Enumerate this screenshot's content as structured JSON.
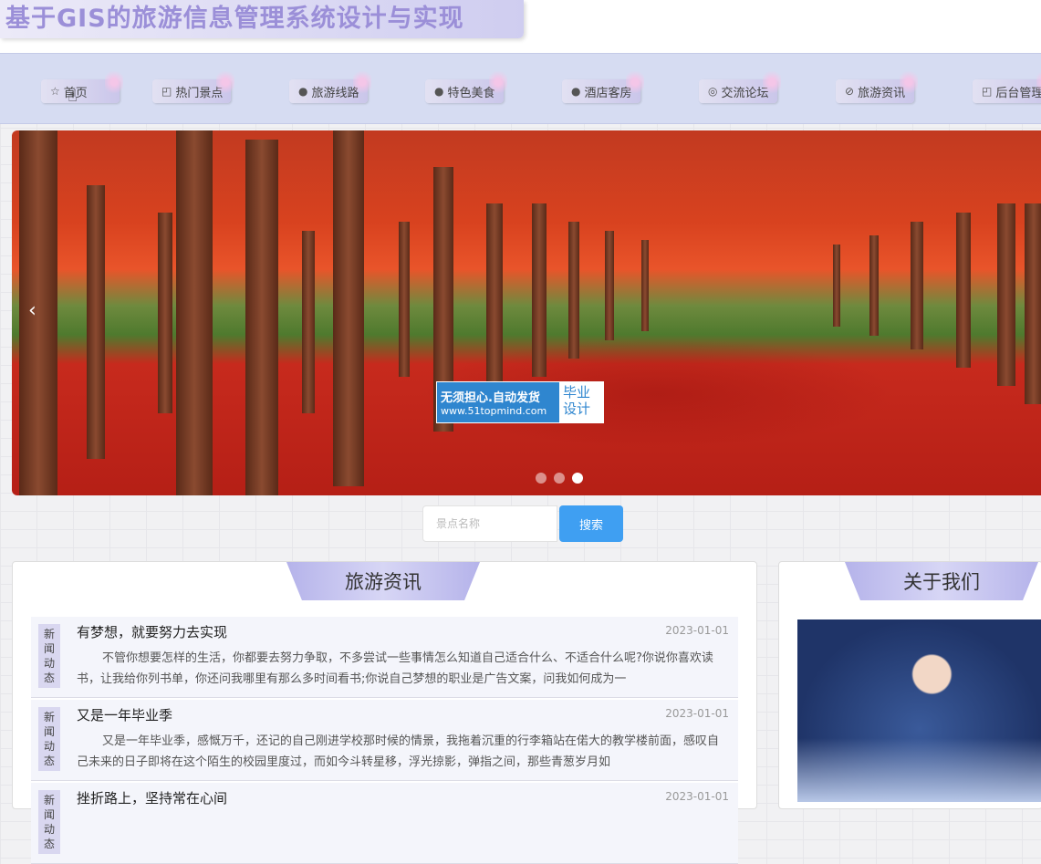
{
  "header": {
    "title": "基于GIS的旅游信息管理系统设计与实现"
  },
  "nav": {
    "items": [
      {
        "icon": "☆",
        "label": "首页"
      },
      {
        "icon": "◰",
        "label": "热门景点"
      },
      {
        "icon": "●",
        "label": "旅游线路"
      },
      {
        "icon": "●",
        "label": "特色美食"
      },
      {
        "icon": "●",
        "label": "酒店客房"
      },
      {
        "icon": "◎",
        "label": "交流论坛"
      },
      {
        "icon": "⊘",
        "label": "旅游资讯"
      },
      {
        "icon": "◰",
        "label": "后台管理"
      }
    ]
  },
  "banner": {
    "prev_icon": "‹",
    "active_slide": 3,
    "watermark": {
      "line1": "无须担心.自动发货",
      "line2": "www.51topmind.com",
      "right": "毕业设计"
    }
  },
  "search": {
    "placeholder": "景点名称",
    "button_label": "搜索"
  },
  "news": {
    "heading": "旅游资讯",
    "items": [
      {
        "tag": [
          "新",
          "闻",
          "动",
          "态"
        ],
        "title": "有梦想，就要努力去实现",
        "date": "2023-01-01",
        "body": "不管你想要怎样的生活，你都要去努力争取，不多尝试一些事情怎么知道自己适合什么、不适合什么呢?你说你喜欢读书，让我给你列书单，你还问我哪里有那么多时间看书;你说自己梦想的职业是广告文案，问我如何成为一"
      },
      {
        "tag": [
          "新",
          "闻",
          "动",
          "态"
        ],
        "title": "又是一年毕业季",
        "date": "2023-01-01",
        "body": "又是一年毕业季，感慨万千，还记的自己刚进学校那时候的情景，我拖着沉重的行李箱站在偌大的教学楼前面，感叹自己未来的日子即将在这个陌生的校园里度过，而如今斗转星移，浮光掠影，弹指之间，那些青葱岁月如"
      },
      {
        "tag": [
          "新",
          "闻",
          "动",
          "态"
        ],
        "title": "挫折路上，坚持常在心间",
        "date": "2023-01-01",
        "body": ""
      }
    ]
  },
  "about": {
    "heading": "关于我们"
  }
}
